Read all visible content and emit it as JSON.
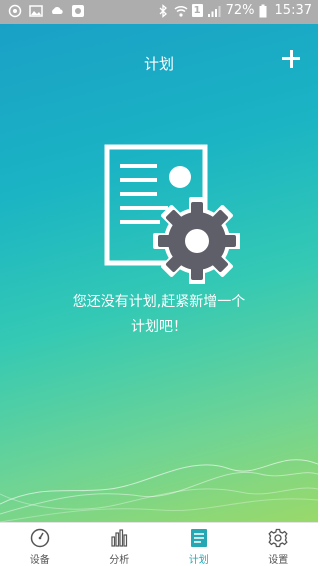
{
  "status_bar": {
    "battery_percent": "72%",
    "time": "15:37",
    "sim_label": "1"
  },
  "header": {
    "title": "计划",
    "add_icon": "plus-icon"
  },
  "empty_state": {
    "icon": "plan-settings-icon",
    "message_line1": "您还没有计划,赶紧新增一个",
    "message_line2": "计划吧！"
  },
  "tabs": [
    {
      "label": "设备",
      "icon": "dashboard-icon",
      "active": false
    },
    {
      "label": "分析",
      "icon": "bar-chart-icon",
      "active": false
    },
    {
      "label": "计划",
      "icon": "plan-icon",
      "active": true
    },
    {
      "label": "设置",
      "icon": "gear-icon",
      "active": false
    }
  ],
  "colors": {
    "active_tab": "#26a7b4",
    "inactive_tab": "#555555",
    "gradient_top": "#1aa0c6",
    "gradient_bottom": "#9ad96a"
  }
}
